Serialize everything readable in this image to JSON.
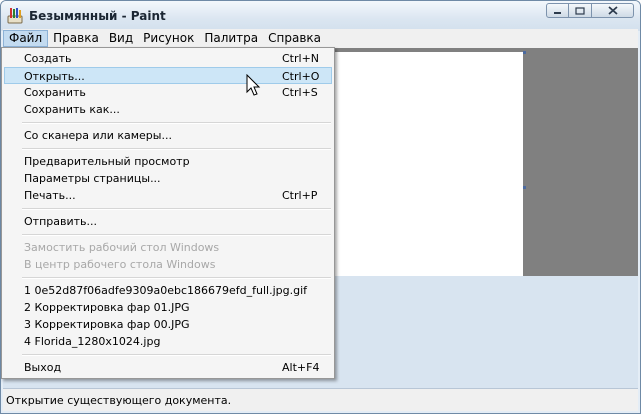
{
  "window": {
    "title": "Безымянный - Paint",
    "icon": "paint-palette-icon"
  },
  "menubar": [
    "Файл",
    "Правка",
    "Вид",
    "Рисунок",
    "Палитра",
    "Справка"
  ],
  "file_menu": {
    "items": [
      {
        "label": "Создать",
        "shortcut": "Ctrl+N"
      },
      {
        "label": "Открыть...",
        "shortcut": "Ctrl+O"
      },
      {
        "label": "Сохранить",
        "shortcut": "Ctrl+S"
      },
      {
        "label": "Сохранить как...",
        "shortcut": ""
      },
      {
        "label": "Со сканера или камеры...",
        "shortcut": ""
      },
      {
        "label": "Предварительный просмотр",
        "shortcut": ""
      },
      {
        "label": "Параметры страницы...",
        "shortcut": ""
      },
      {
        "label": "Печать...",
        "shortcut": "Ctrl+P"
      },
      {
        "label": "Отправить...",
        "shortcut": ""
      },
      {
        "label": "Замостить рабочий стол Windows",
        "shortcut": ""
      },
      {
        "label": "В центр рабочего стола Windows",
        "shortcut": ""
      },
      {
        "label": "1 0e52d87f06adfe9309a0ebc186679efd_full.jpg.gif",
        "shortcut": ""
      },
      {
        "label": "2 Корректировка фар 01.JPG",
        "shortcut": ""
      },
      {
        "label": "3 Корректировка фар 00.JPG",
        "shortcut": ""
      },
      {
        "label": "4 Florida_1280x1024.jpg",
        "shortcut": ""
      },
      {
        "label": "Выход",
        "shortcut": "Alt+F4"
      }
    ]
  },
  "status": {
    "text": "Открытие существующего документа."
  },
  "colors": {
    "highlight": "#cde6f7",
    "workspace": "#808080",
    "disabled_text": "#a8a8a8"
  }
}
